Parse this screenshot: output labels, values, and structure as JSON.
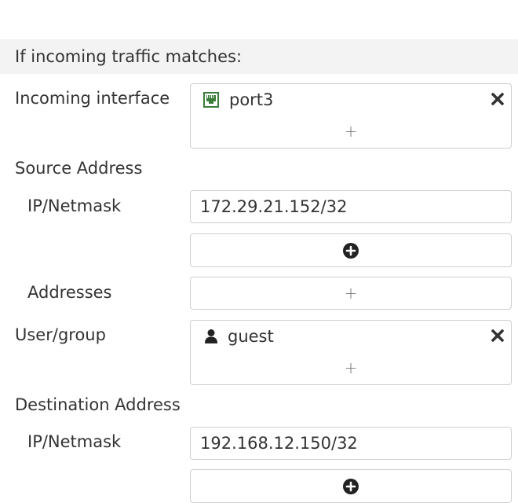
{
  "section": {
    "title": "If incoming traffic matches:"
  },
  "incoming_interface": {
    "label": "Incoming interface",
    "chip_label": "port3",
    "chip_icon": "network-port-icon",
    "add_label": "+"
  },
  "source": {
    "heading": "Source Address",
    "ip_label": "IP/Netmask",
    "ip_value": "172.29.21.152/32",
    "addresses_label": "Addresses",
    "add_label": "+"
  },
  "user_group": {
    "label": "User/group",
    "chip_label": "guest",
    "chip_icon": "user-icon",
    "add_label": "+"
  },
  "destination": {
    "heading": "Destination Address",
    "ip_label": "IP/Netmask",
    "ip_value": "192.168.12.150/32"
  },
  "colors": {
    "port_icon": "#3a7d3a",
    "header_bg": "#f3f3f3",
    "border": "#cfcfcf",
    "text": "#333333"
  }
}
